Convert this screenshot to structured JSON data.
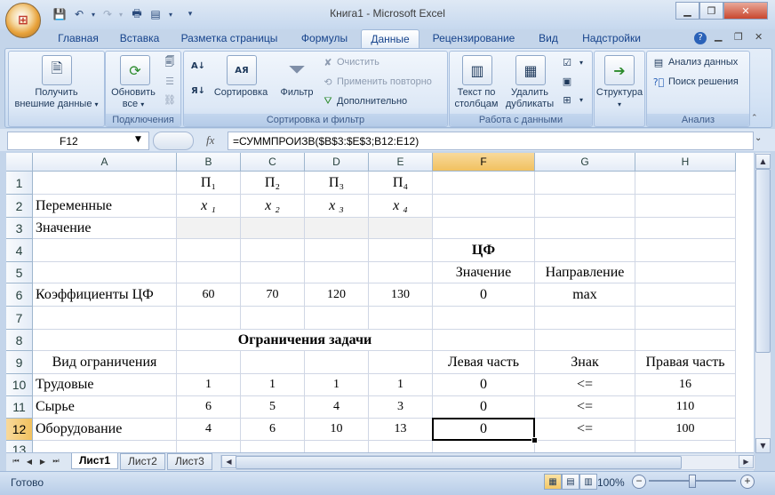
{
  "window": {
    "title": "Книга1 - Microsoft Excel"
  },
  "ribbon": {
    "tabs": [
      "Главная",
      "Вставка",
      "Разметка страницы",
      "Формулы",
      "Данные",
      "Рецензирование",
      "Вид",
      "Надстройки"
    ],
    "active_tab": "Данные",
    "groups": {
      "external": {
        "btn1": "Получить",
        "btn2": "внешние данные"
      },
      "connections": {
        "title": "Подключения",
        "refresh1": "Обновить",
        "refresh2": "все"
      },
      "sortfilter": {
        "title": "Сортировка и фильтр",
        "sort": "Сортировка",
        "filter": "Фильтр",
        "clear": "Очистить",
        "reapply": "Применить повторно",
        "advanced": "Дополнительно"
      },
      "datatools": {
        "title": "Работа с данными",
        "text1": "Текст по",
        "text2": "столбцам",
        "dup1": "Удалить",
        "dup2": "дубликаты"
      },
      "outline": {
        "btn": "Структура"
      },
      "analysis": {
        "title": "Анализ",
        "data_analysis": "Анализ данных",
        "solver": "Поиск решения"
      }
    }
  },
  "formula_bar": {
    "name_box": "F12",
    "fx": "fx",
    "formula": "=СУММПРОИЗВ($B$3:$E$3;B12:E12)"
  },
  "grid": {
    "columns": [
      "A",
      "B",
      "C",
      "D",
      "E",
      "F",
      "G",
      "H"
    ],
    "rows": [
      "1",
      "2",
      "3",
      "4",
      "5",
      "6",
      "7",
      "8",
      "9",
      "10",
      "11",
      "12",
      "13"
    ],
    "selected_cell": "F12",
    "cells": {
      "B1": "П₁",
      "C1": "П₂",
      "D1": "П₃",
      "E1": "П₄",
      "A2": "Переменные",
      "B2": "x ₁",
      "C2": "x ₂",
      "D2": "x ₃",
      "E2": "x ₄",
      "A3": "Значение",
      "F4": "ЦФ",
      "F5": "Значение",
      "G5": "Направление",
      "A6": "Коэффициенты ЦФ",
      "B6": "60",
      "C6": "70",
      "D6": "120",
      "E6": "130",
      "F6": "0",
      "G6": "max",
      "B8": "Ограничения задачи",
      "A9": "Вид ограничения",
      "F9": "Левая часть",
      "G9": "Знак",
      "H9": "Правая часть",
      "A10": "Трудовые",
      "B10": "1",
      "C10": "1",
      "D10": "1",
      "E10": "1",
      "F10": "0",
      "G10": "<=",
      "H10": "16",
      "A11": "Сырье",
      "B11": "6",
      "C11": "5",
      "D11": "4",
      "E11": "3",
      "F11": "0",
      "G11": "<=",
      "H11": "110",
      "A12": "Оборудование",
      "B12": "4",
      "C12": "6",
      "D12": "10",
      "E12": "13",
      "F12": "0",
      "G12": "<=",
      "H12": "100"
    }
  },
  "sheets": {
    "tabs": [
      "Лист1",
      "Лист2",
      "Лист3"
    ],
    "active": "Лист1"
  },
  "status": {
    "text": "Готово",
    "zoom": "100%"
  }
}
